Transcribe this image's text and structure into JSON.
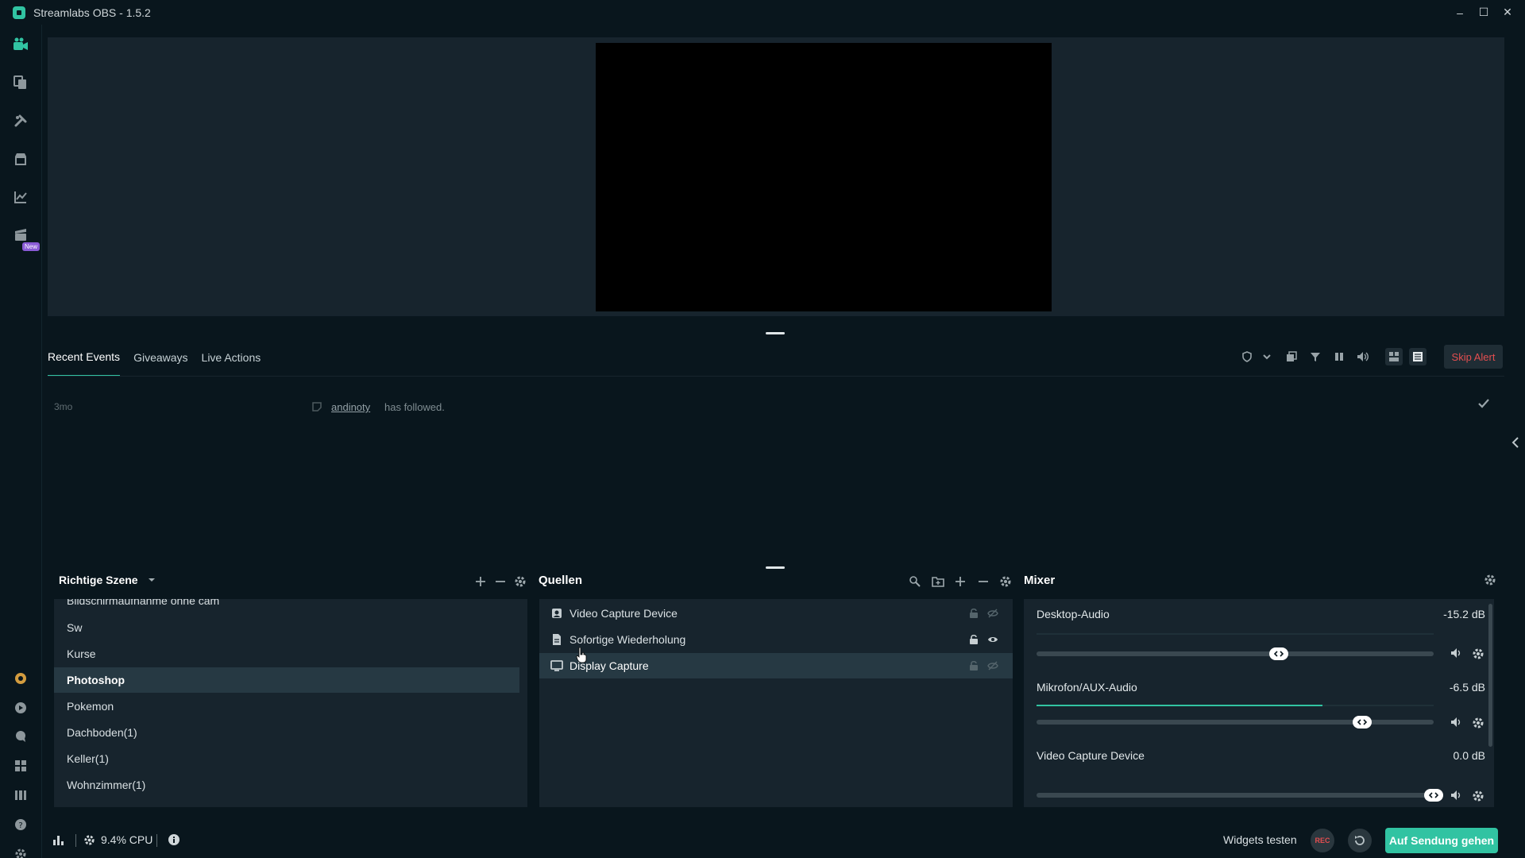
{
  "window": {
    "title": "Streamlabs OBS - 1.5.2",
    "controls": {
      "minimize": "–",
      "maximize": "☐",
      "close": "✕"
    }
  },
  "nav": {
    "items": [
      {
        "name": "editor-icon",
        "active": true
      },
      {
        "name": "themes-icon"
      },
      {
        "name": "app-store-icon"
      },
      {
        "name": "store-icon"
      },
      {
        "name": "dashboard-icon"
      },
      {
        "name": "highlighter-icon",
        "badge": "New"
      }
    ],
    "bottom": [
      "prime-icon",
      "alert-box-icon",
      "chat-icon",
      "layout-icon",
      "studio-mode-icon",
      "help-icon",
      "settings-icon"
    ]
  },
  "events": {
    "tabs": [
      {
        "label": "Recent Events",
        "active": true
      },
      {
        "label": "Giveaways"
      },
      {
        "label": "Live Actions"
      }
    ],
    "skip_alert": "Skip Alert",
    "items": [
      {
        "time": "3mo",
        "user": "andinoty",
        "text": "has followed."
      }
    ]
  },
  "scenes": {
    "title": "Richtige Szene",
    "items": [
      {
        "label": "Bildschirmaufnahme ohne cam"
      },
      {
        "label": "Sw"
      },
      {
        "label": "Kurse"
      },
      {
        "label": "Photoshop",
        "selected": true
      },
      {
        "label": "Pokemon"
      },
      {
        "label": "Dachboden(1)"
      },
      {
        "label": "Keller(1)"
      },
      {
        "label": "Wohnzimmer(1)"
      }
    ]
  },
  "sources": {
    "title": "Quellen",
    "items": [
      {
        "label": "Video Capture Device",
        "icon": "camera-icon"
      },
      {
        "label": "Sofortige Wiederholung",
        "icon": "file-icon",
        "visible": true
      },
      {
        "label": "Display Capture",
        "icon": "monitor-icon",
        "selected": true
      }
    ]
  },
  "mixer": {
    "title": "Mixer",
    "channels": [
      {
        "name": "Desktop-Audio",
        "db": "-15.2 dB",
        "level": 0.61,
        "meter": 0.0
      },
      {
        "name": "Mikrofon/AUX-Audio",
        "db": "-6.5 dB",
        "level": 0.82,
        "meter": 0.72
      },
      {
        "name": "Video Capture Device",
        "db": "0.0 dB",
        "level": 1.0,
        "meter": 0.0
      }
    ]
  },
  "footer": {
    "cpu": "9.4% CPU",
    "widgets": "Widgets testen",
    "rec": "REC",
    "go_live": "Auf Sendung gehen"
  },
  "colors": {
    "accent": "#31c3a2",
    "danger": "#e34e50",
    "background": "#09161d",
    "panel": "#17242d"
  }
}
